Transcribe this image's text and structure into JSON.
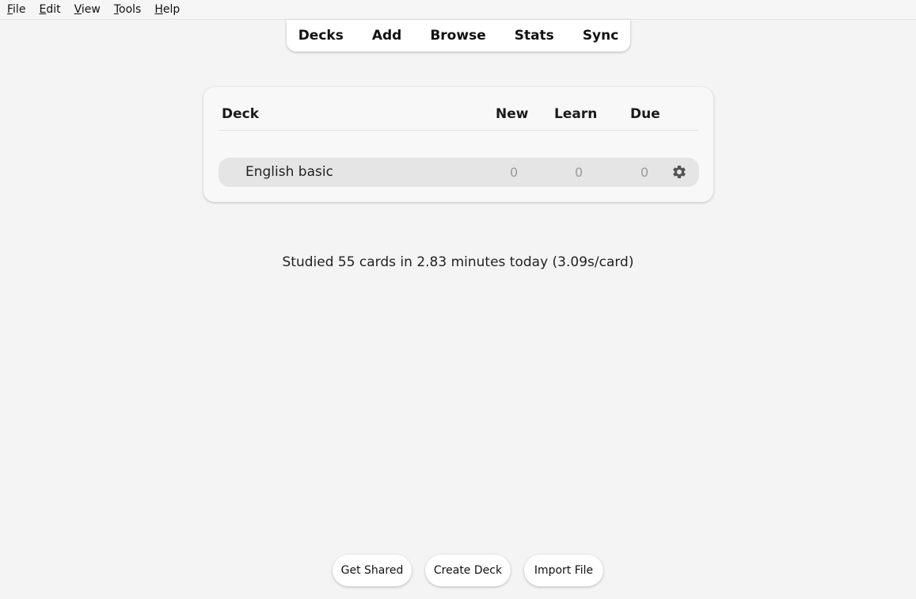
{
  "menubar": {
    "items": [
      {
        "label": "File",
        "accel": "F",
        "rest": "ile"
      },
      {
        "label": "Edit",
        "accel": "E",
        "rest": "dit"
      },
      {
        "label": "View",
        "accel": "V",
        "rest": "iew"
      },
      {
        "label": "Tools",
        "accel": "T",
        "rest": "ools"
      },
      {
        "label": "Help",
        "accel": "H",
        "rest": "elp"
      }
    ]
  },
  "toolbar": {
    "decks": "Decks",
    "add": "Add",
    "browse": "Browse",
    "stats": "Stats",
    "sync": "Sync"
  },
  "deck_table": {
    "headers": {
      "deck": "Deck",
      "new": "New",
      "learn": "Learn",
      "due": "Due"
    },
    "rows": [
      {
        "name": "English basic",
        "new": "0",
        "learn": "0",
        "due": "0",
        "options_icon": "gear-icon"
      }
    ]
  },
  "study_summary": "Studied 55 cards in 2.83 minutes today (3.09s/card)",
  "bottom_buttons": {
    "get_shared": "Get Shared",
    "create_deck": "Create Deck",
    "import_file": "Import File"
  },
  "colors": {
    "background": "#f4f4f4",
    "row_background": "#e5e5e5",
    "count_zero": "#9a9a9a"
  }
}
